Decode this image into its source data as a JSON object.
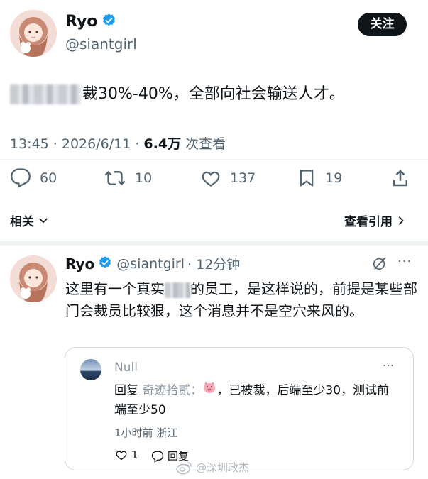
{
  "tweet": {
    "author_name": "Ryo",
    "author_handle": "@siantgirl",
    "follow_label": "关注",
    "text": "裁30%-40%，全部向社会输送人才。",
    "time": "13:45 · 2026/6/11 · ",
    "views": "6.4万",
    "views_suffix": " 次查看",
    "actions": {
      "replies": "60",
      "retweets": "10",
      "likes": "137",
      "bookmarks": "19"
    },
    "related_label": "相关",
    "quotes_label": "查看引用"
  },
  "reply": {
    "author_name": "Ryo",
    "author_handle": "@siantgirl",
    "time": "· 12分钟",
    "text_part1": "这里有一个真实",
    "text_part2": "的员工，是这样说的，前提是某些部门会裁员比较狠，这个消息并不是空穴来风的。",
    "more_label": "···"
  },
  "quoted": {
    "author_name": "Null",
    "prefix": "回复 ",
    "mention": "奇迹拾贰：",
    "body": "，已被裁，后端至少30，测试前端至少50",
    "meta": "1小时前 浙江",
    "like_count": "1",
    "reply_label": "回复",
    "more_label": "···"
  },
  "watermark": "@深圳政杰",
  "colors": {
    "text_primary": "#0f1419",
    "text_secondary": "#536471",
    "verified": "#1d9bf0",
    "button_bg": "#0f1419"
  }
}
